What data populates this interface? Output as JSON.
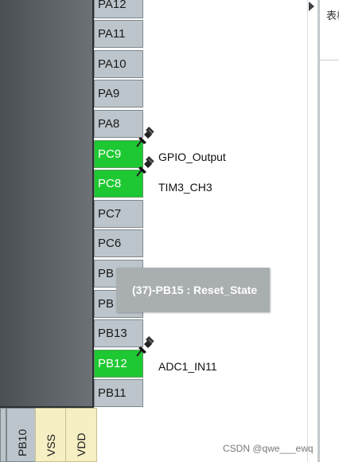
{
  "right_pins": [
    {
      "name": "PA12",
      "state": "default"
    },
    {
      "name": "PA11",
      "state": "default"
    },
    {
      "name": "PA10",
      "state": "default"
    },
    {
      "name": "PA9",
      "state": "default"
    },
    {
      "name": "PA8",
      "state": "default"
    },
    {
      "name": "PC9",
      "state": "assigned",
      "label": "GPIO_Output"
    },
    {
      "name": "PC8",
      "state": "assigned",
      "label": "TIM3_CH3"
    },
    {
      "name": "PC7",
      "state": "default"
    },
    {
      "name": "PC6",
      "state": "default"
    },
    {
      "name": "PB",
      "state": "default"
    },
    {
      "name": "PB",
      "state": "default"
    },
    {
      "name": "PB13",
      "state": "default"
    },
    {
      "name": "PB12",
      "state": "assigned",
      "label": "ADC1_IN11"
    },
    {
      "name": "PB11",
      "state": "default"
    }
  ],
  "bottom_pins": [
    {
      "name": "PB10",
      "kind": "io"
    },
    {
      "name": "VSS",
      "kind": "power"
    },
    {
      "name": "VDD",
      "kind": "power"
    }
  ],
  "tooltip": {
    "text": "(37)-PB15 : Reset_State"
  },
  "side_panel": {
    "text": "表格"
  },
  "watermark": "CSDN @qwe___ewq",
  "colors": {
    "pin_default": "#bcc5cb",
    "pin_assigned": "#1ec832",
    "power_pin": "#f6efc4",
    "tooltip_bg": "#a9aeb1"
  },
  "icons": {
    "assigned_marker": "pushpin-icon"
  }
}
